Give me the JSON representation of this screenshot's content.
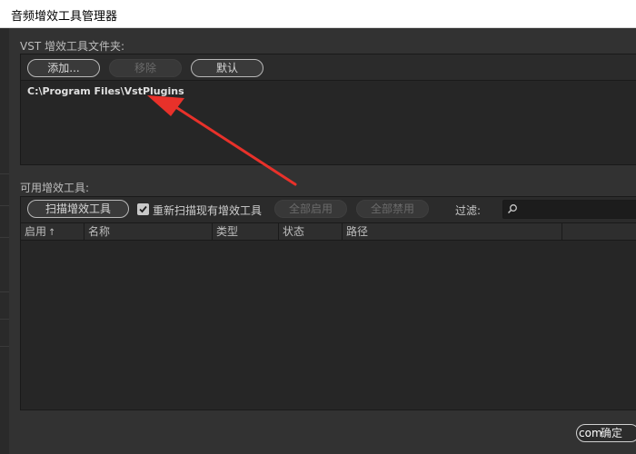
{
  "window": {
    "title": "音频增效工具管理器"
  },
  "vst_section": {
    "label": "VST 增效工具文件夹:",
    "buttons": {
      "add": "添加...",
      "remove": "移除",
      "default": "默认"
    },
    "folders": [
      "C:\\Program Files\\VstPlugins"
    ]
  },
  "plugins_section": {
    "label": "可用增效工具:",
    "scan_button": "扫描增效工具",
    "rescan_checkbox": {
      "label": "重新扫描现有增效工具",
      "checked": true
    },
    "enable_all_button": "全部启用",
    "disable_all_button": "全部禁用",
    "filter_label": "过滤:",
    "filter_value": "",
    "table": {
      "columns": [
        "启用",
        "名称",
        "类型",
        "状态",
        "路径"
      ],
      "sort_indicator": "↑",
      "rows": []
    }
  },
  "footer": {
    "ok_button": "确定",
    "ok_ghost_text": "com"
  },
  "annotation": {
    "arrow_color": "#e8312a"
  }
}
